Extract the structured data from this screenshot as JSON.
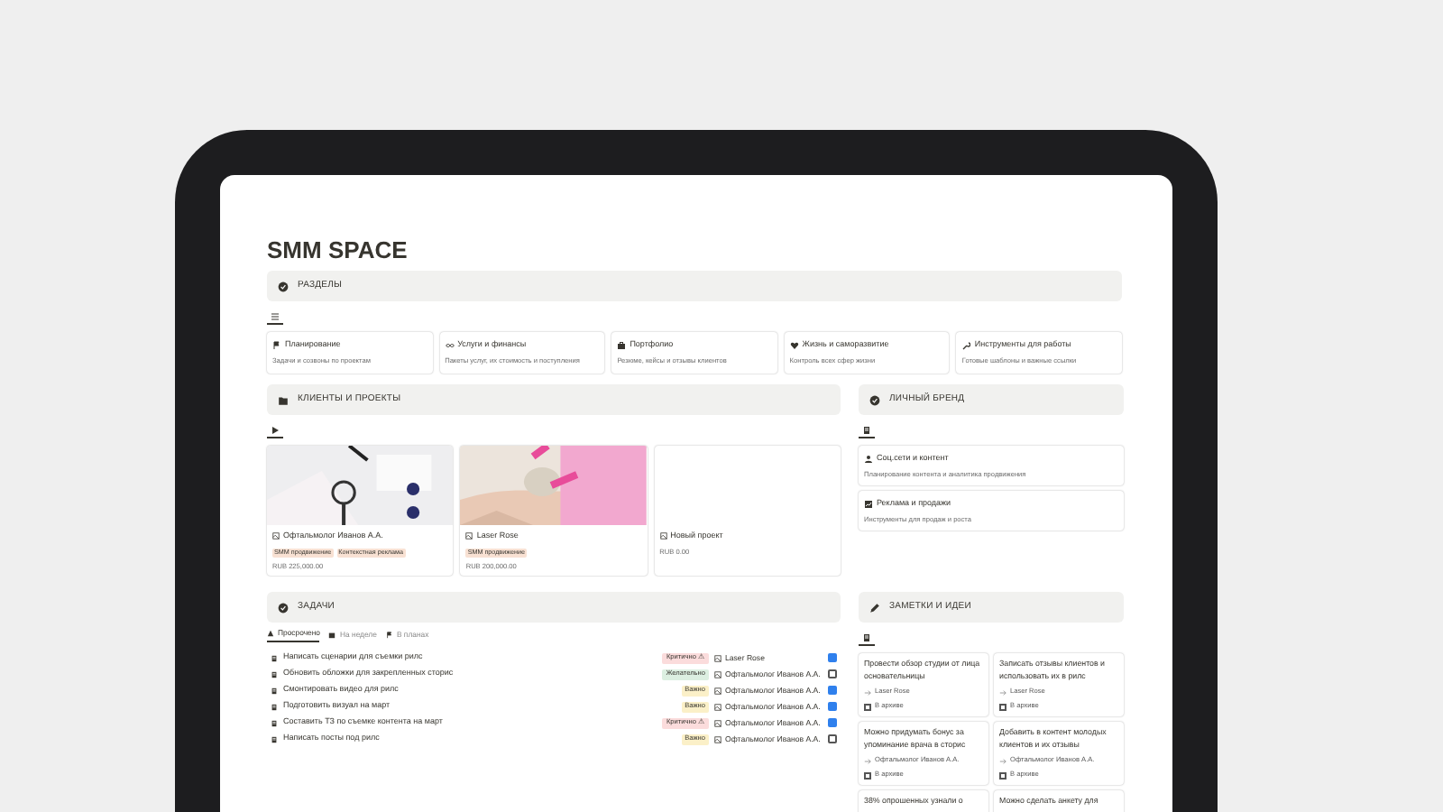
{
  "page": {
    "title": "SMM SPACE"
  },
  "sections": {
    "header": "РАЗДЕЛЫ",
    "cards": [
      {
        "title": "Планирование",
        "description": "Задачи и созвоны по проектам"
      },
      {
        "title": "Услуги и финансы",
        "description": "Пакеты услуг, их стоимость и поступления"
      },
      {
        "title": "Портфолио",
        "description": "Резюме, кейсы и отзывы клиентов"
      },
      {
        "title": "Жизнь и саморазвитие",
        "description": "Контроль всех сфер жизни"
      },
      {
        "title": "Инструменты для работы",
        "description": "Готовые шаблоны и важные ссылки"
      }
    ]
  },
  "clients": {
    "header": "КЛИЕНТЫ И ПРОЕКТЫ",
    "cards": [
      {
        "kind": "picture",
        "title": "Офтальмолог Иванов А.А.",
        "tags": [
          {
            "label": "SMM продвижение",
            "color": "#f8e1d3"
          },
          {
            "label": "Контекстная реклама",
            "color": "#f8e1d3"
          }
        ],
        "price": "RUB 225,000.00"
      },
      {
        "kind": "picture",
        "title": "Laser Rose",
        "tags": [
          {
            "label": "SMM продвижение",
            "color": "#f8e1d3"
          }
        ],
        "price": "RUB 200,000.00"
      },
      {
        "kind": "blank",
        "title": "Новый проект",
        "price": "RUB 0.00"
      }
    ]
  },
  "brand": {
    "header": "ЛИЧНЫЙ БРЕНД",
    "cards": [
      {
        "title": "Соц.сети и контент",
        "description": "Планирование контента и аналитика продвижения"
      },
      {
        "title": "Реклама и продажи",
        "description": "Инструменты для продаж и роста"
      }
    ]
  },
  "tasks": {
    "header": "ЗАДАЧИ",
    "tabs": [
      {
        "label": "Просрочено",
        "selected": true
      },
      {
        "label": "На неделе",
        "selected": false
      },
      {
        "label": "В планах",
        "selected": false
      }
    ],
    "rows": [
      {
        "text": "Написать сценарии для съемки рилс",
        "tag": "Критично ⚠",
        "color": "#fbdcdc",
        "project": "Laser Rose",
        "checked": true
      },
      {
        "text": "Обновить обложки для закрепленных сторис",
        "tag": "Желательно",
        "color": "#dcefe1",
        "project": "Офтальмолог Иванов А.А.",
        "checked": false
      },
      {
        "text": "Смонтировать видео для рилс",
        "tag": "Важно",
        "color": "#fbf0c8",
        "project": "Офтальмолог Иванов А.А.",
        "checked": true
      },
      {
        "text": "Подготовить визуал на март",
        "tag": "Важно",
        "color": "#fbf0c8",
        "project": "Офтальмолог Иванов А.А.",
        "checked": true
      },
      {
        "text": "Составить ТЗ по съемке контента на март",
        "tag": "Критично ⚠",
        "color": "#fbdcdc",
        "project": "Офтальмолог Иванов А.А.",
        "checked": true
      },
      {
        "text": "Написать посты под рилс",
        "tag": "Важно",
        "color": "#fbf0c8",
        "project": "Офтальмолог Иванов А.А.",
        "checked": false
      }
    ]
  },
  "notes": {
    "header": "ЗАМЕТКИ И ИДЕИ",
    "cards": [
      {
        "text": "Провести обзор студии от лица основательницы",
        "project": "Laser Rose",
        "archive": "В архиве",
        "archived": false
      },
      {
        "text": "Записать отзывы клиентов и использовать их в рилс",
        "project": "Laser Rose",
        "archive": "В архиве",
        "archived": false
      },
      {
        "text": "Можно придумать бонус за упоминание врача в сторис",
        "project": "Офтальмолог Иванов А.А.",
        "archive": "В архиве",
        "archived": false
      },
      {
        "text": "Добавить в контент молодых клиентов и их отзывы",
        "project": "Офтальмолог Иванов А.А.",
        "archive": "В архиве",
        "archived": false
      },
      {
        "text": "38% опрошенных узнали о"
      },
      {
        "text": "Можно сделать анкету для"
      }
    ]
  }
}
